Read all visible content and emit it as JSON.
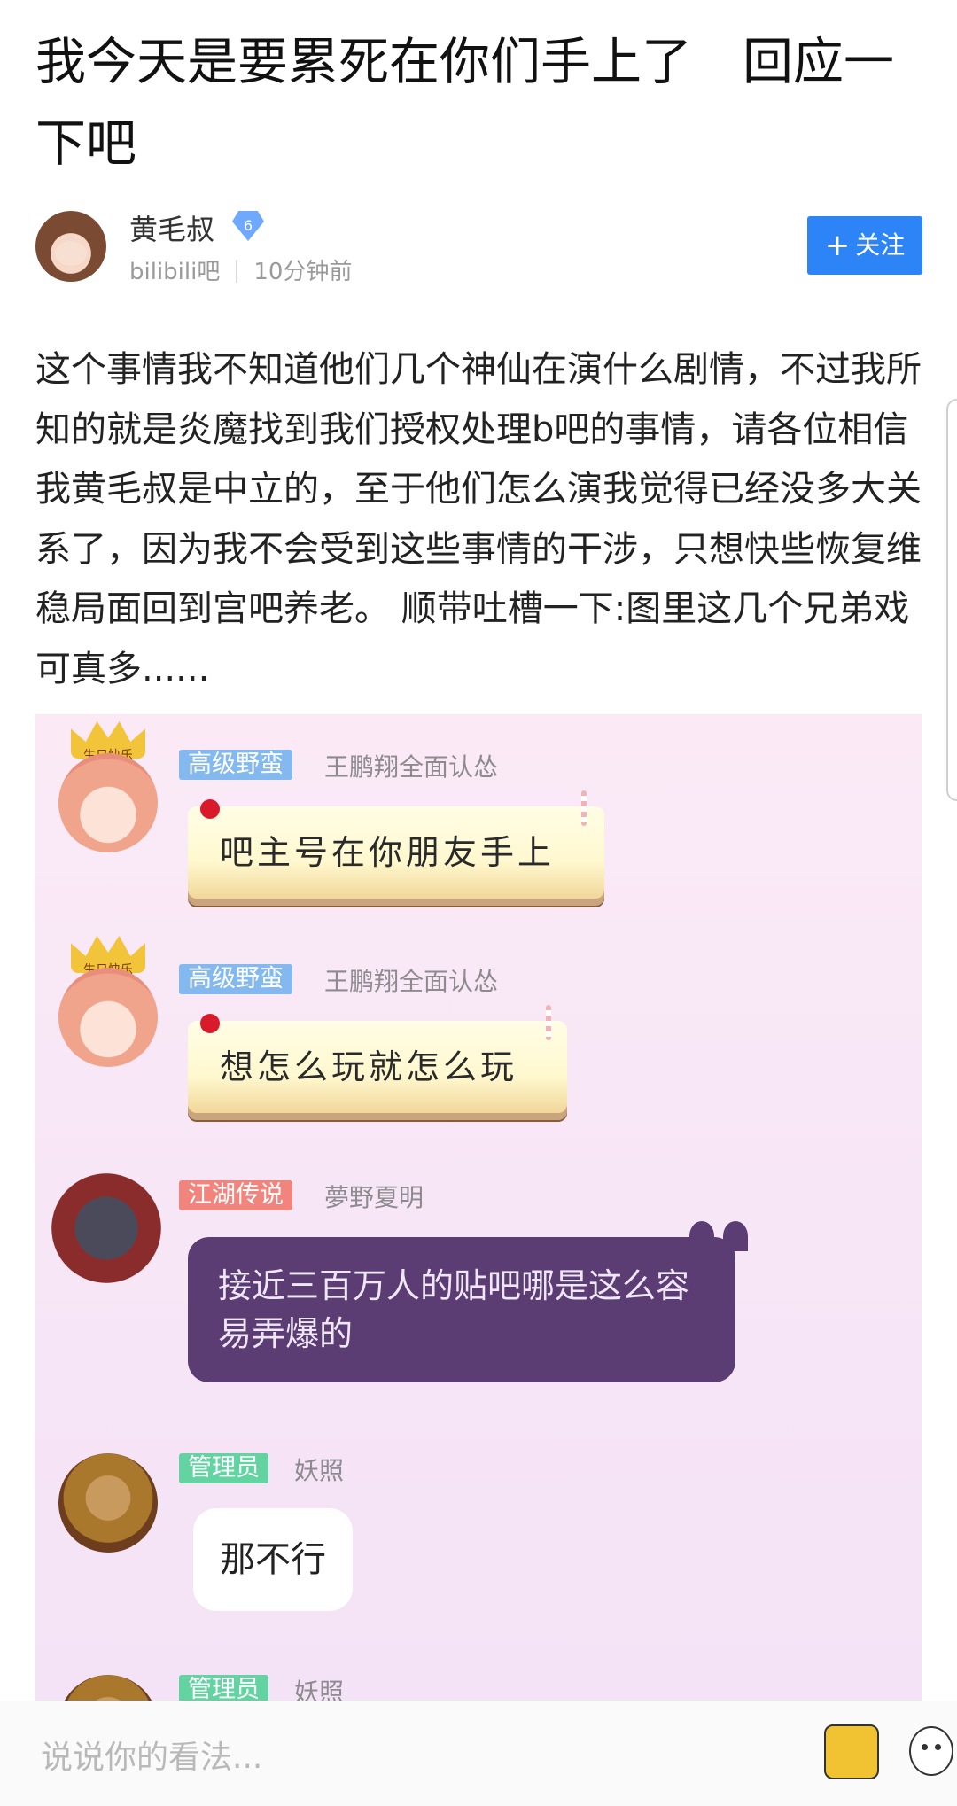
{
  "post": {
    "title": "我今天是要累死在你们手上了　回应一下吧",
    "author": {
      "name": "黄毛叔",
      "level": "6",
      "forum": "bilibili吧",
      "time": "10分钟前"
    },
    "follow_label": "关注",
    "follow_plus": "+",
    "body": "这个事情我不知道他们几个神仙在演什么剧情，不过我所知的就是炎魔找到我们授权处理b吧的事情，请各位相信我黄毛叔是中立的，至于他们怎么演我觉得已经没多大关系了，因为我不会受到这些事情的干涉，只想快些恢复维稳局面回到宫吧养老。 顺带吐槽一下:图里这几个兄弟戏可真多......"
  },
  "chat": {
    "messages": [
      {
        "tag": "高级野蛮",
        "user": "王鹏翔全面认怂",
        "text": "吧主号在你朋友手上",
        "badge": "生日快乐"
      },
      {
        "tag": "高级野蛮",
        "user": "王鹏翔全面认怂",
        "text": "想怎么玩就怎么玩",
        "badge": "生日快乐"
      },
      {
        "tag": "江湖传说",
        "user": "夢野夏明",
        "text": "接近三百万人的贴吧哪是这么容易弄爆的"
      },
      {
        "tag": "管理员",
        "user": "妖照",
        "text": "那不行"
      },
      {
        "tag": "管理员",
        "user": "妖照"
      }
    ]
  },
  "comment_bar": {
    "placeholder": "说说你的看法..."
  },
  "colors": {
    "accent": "#2d84f7",
    "chat_bg": "#f7e6f6",
    "tag_blue": "#83b9ef",
    "tag_red": "#f1857d",
    "tag_green": "#63d3a2"
  }
}
